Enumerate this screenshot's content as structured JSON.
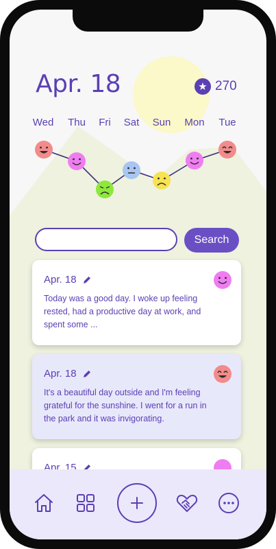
{
  "header": {
    "date": "Apr. 18",
    "star_count": "270",
    "star_icon": "star-icon"
  },
  "week": {
    "days": [
      "Wed",
      "Thu",
      "Fri",
      "Sat",
      "Sun",
      "Mon",
      "Tue"
    ],
    "moods": [
      "happy",
      "happy",
      "sad",
      "neutral",
      "sad",
      "happy",
      "happy"
    ]
  },
  "mood_colors": {
    "happy_red": "#f28b8b",
    "happy_pink": "#ef7df1",
    "sad_green": "#8ee83c",
    "neutral_blue": "#a9c5f2",
    "sad_yellow": "#f7e251"
  },
  "search": {
    "placeholder": "",
    "button_label": "Search"
  },
  "entries": [
    {
      "date": "Apr. 18",
      "text": "Today was a good day. I woke up feeling rested, had a productive day at work, and spent some ...",
      "mood": "happy"
    },
    {
      "date": "Apr. 18",
      "text": "It's a beautiful day outside and I'm feeling grateful for the sunshine. I went for a run in the park and it was invigorating.",
      "mood": "happy"
    },
    {
      "date": "Apr. 15",
      "text": "",
      "mood": "happy"
    }
  ],
  "nav": {
    "items": [
      "home-icon",
      "grid-icon",
      "add-icon",
      "heart-handshake-icon",
      "more-icon"
    ]
  },
  "theme": {
    "accent": "#5b3fb3",
    "button": "#6a4fc4",
    "card_highlight": "#e8e8fb",
    "nav_bg": "#ebe8fb",
    "sun": "#fbf8c9",
    "hills": "#eef2df"
  }
}
